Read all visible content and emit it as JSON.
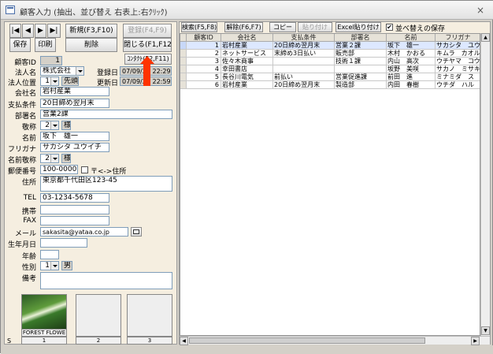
{
  "window": {
    "title": "顧客入力 (抽出、並び替え 右表上:右ｸﾘｯｸ)",
    "close": "×"
  },
  "nav": {
    "first": "|◀",
    "prev": "◀",
    "next": "▶",
    "last": "▶|"
  },
  "buttons": {
    "new": "新規(F3,F10)",
    "register": "登録(F4,F9)",
    "save": "保存",
    "print": "印刷",
    "delete": "削除",
    "close": "閉じる(F1,F12)",
    "contact": "ｺﾝﾀｸﾄ(F2,F11)"
  },
  "form": {
    "customer_id": {
      "label": "顧客ID",
      "value": "1"
    },
    "corp_name": {
      "label": "法人名",
      "value": "株式会社"
    },
    "registered": {
      "label": "登録日",
      "value": "07/09/27 22:29:28"
    },
    "corp_pos": {
      "label": "法人位置",
      "value": "1",
      "suffix": "先頭"
    },
    "updated": {
      "label": "更新日",
      "value": "07/09/27 22:59"
    },
    "company": {
      "label": "会社名",
      "value": "岩村産業"
    },
    "payment": {
      "label": "支払条件",
      "value": "20日締め翌月末"
    },
    "dept": {
      "label": "部署名",
      "value": "営業2課"
    },
    "title": {
      "label": "敬称",
      "value": "2",
      "suffix": "様"
    },
    "name": {
      "label": "名前",
      "value": "坂下　雄一"
    },
    "furigana": {
      "label": "フリガナ",
      "value": "サカシタ ユウイチ"
    },
    "name_title": {
      "label": "名前敬称",
      "value": "2",
      "suffix": "様"
    },
    "postal": {
      "label": "郵便番号",
      "value": "100-0000",
      "check_label": "〒<->住所"
    },
    "address": {
      "label": "住所",
      "value": "東京都千代田区123-45"
    },
    "tel": {
      "label": "TEL",
      "value": "03-1234-5678"
    },
    "mobile": {
      "label": "携帯",
      "value": ""
    },
    "fax": {
      "label": "FAX",
      "value": ""
    },
    "mail": {
      "label": "メール",
      "value": "sakasita@yataa.co.jp"
    },
    "birth": {
      "label": "生年月日",
      "value": ""
    },
    "age": {
      "label": "年齢",
      "value": ""
    },
    "gender": {
      "label": "性別",
      "value": "1",
      "suffix": "男"
    },
    "notes": {
      "label": "備考",
      "value": ""
    }
  },
  "thumbs": [
    {
      "caption": "FOREST FLOWE",
      "num": "1"
    },
    {
      "caption": "",
      "num": "2"
    },
    {
      "caption": "",
      "num": "3"
    }
  ],
  "s_label": "S",
  "toolbar": {
    "search": "検索(F5,F8)",
    "clear": "解除(F6,F7)",
    "copy": "コピー",
    "paste": "貼り付け",
    "excel": "Excel貼り付け",
    "keep_sort": "並べ替えの保存",
    "keep_sort_checked": "✔"
  },
  "grid": {
    "headers": [
      "顧客ID",
      "会社名",
      "支払条件",
      "部署名",
      "名前",
      "フリガナ"
    ],
    "rows": [
      [
        "1",
        "岩村産業",
        "20日締め翌月末",
        "営業２課",
        "坂下　雄一",
        "サカシタ　ユウ"
      ],
      [
        "2",
        "ネットサービス",
        "末締め3日払い",
        "販売部",
        "木村　かおる",
        "キムラ　カオル"
      ],
      [
        "3",
        "佐々木商事",
        "",
        "技術１課",
        "内山　高次",
        "ウチヤマ　コウ"
      ],
      [
        "4",
        "幸田書店",
        "",
        "",
        "坂野　美咲",
        "サカノ　ミサキ"
      ],
      [
        "5",
        "長谷川電気",
        "前払い",
        "営業促進課",
        "前田　進",
        "ミナミダ　ス"
      ],
      [
        "6",
        "岩村産業",
        "20日締め翌月末",
        "製造部",
        "内田　春樹",
        "ウチダ　ハル"
      ]
    ]
  }
}
